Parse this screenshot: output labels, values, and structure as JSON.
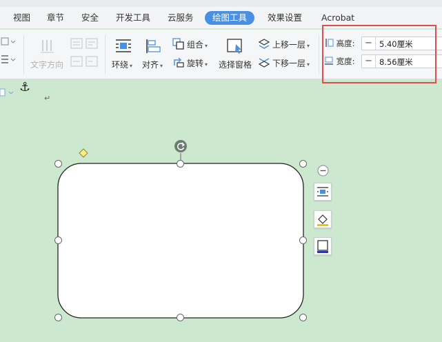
{
  "tabs": [
    "视图",
    "章节",
    "安全",
    "开发工具",
    "云服务",
    "绘图工具",
    "效果设置",
    "Acrobat"
  ],
  "active_tab": "绘图工具",
  "ribbon": {
    "text_direction": "文字方向",
    "wrap": "环绕",
    "align": "对齐",
    "group": "组合",
    "rotate": "旋转",
    "selection_pane": "选择窗格",
    "bring_forward": "上移一层",
    "send_backward": "下移一层"
  },
  "size": {
    "height_label": "高度:",
    "height_value": "5.40厘米",
    "width_label": "宽度:",
    "width_value": "8.56厘米",
    "minus": "−",
    "plus": "+"
  },
  "doc": {
    "paragraph_mark": "↵",
    "anchor": "⚓"
  },
  "colors": {
    "accent": "#4a90e2",
    "highlight_border": "#e14c4c",
    "canvas_bg": "#cce8cf",
    "adjust_handle": "#ffeb80"
  }
}
